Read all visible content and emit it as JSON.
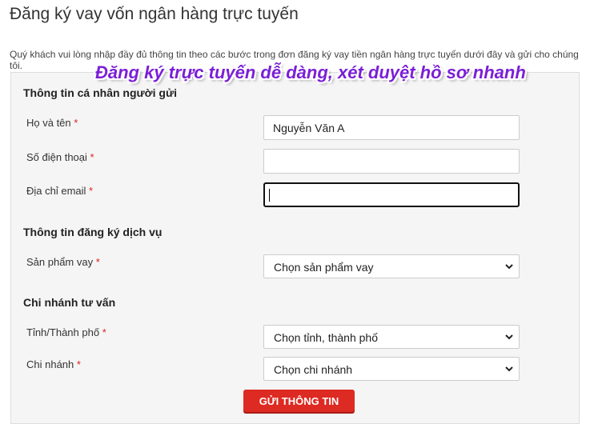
{
  "page": {
    "title": "Đăng ký vay vốn ngân hàng trực tuyến",
    "intro": "Quý khách vui lòng nhập đầy đủ thông tin theo các bước trong đơn đăng ký vay tiền ngân hàng trực tuyến dưới đây và gửi cho chúng tôi.",
    "banner": "Đăng ký trực tuyến dễ dàng, xét duyệt hồ sơ nhanh"
  },
  "personal": {
    "heading": "Thông tin cá nhân người gửi",
    "name_label": "Họ và tên",
    "name_value": "Nguyễn Văn A",
    "phone_label": "Số điện thoại",
    "phone_value": "",
    "email_label": "Địa chỉ email",
    "email_value": ""
  },
  "service": {
    "heading": "Thông tin đăng ký dịch vụ",
    "product_label": "Sản phẩm vay",
    "product_selected": "Chọn sản phẩm vay"
  },
  "branch": {
    "heading": "Chi nhánh tư vấn",
    "city_label": "Tỉnh/Thành phố",
    "city_selected": "Chọn tỉnh, thành phố",
    "branch_label": "Chi nhánh",
    "branch_selected": "Chọn chi nhánh"
  },
  "required_mark": "*",
  "submit_label": "GỬI THÔNG TIN",
  "colors": {
    "required": "#e02020",
    "submit_button": "#dd2a22",
    "banner_text": "#7b1fd6",
    "form_background": "#f5f5f5"
  },
  "icons": {
    "select_arrow": "chevron-down-icon"
  }
}
